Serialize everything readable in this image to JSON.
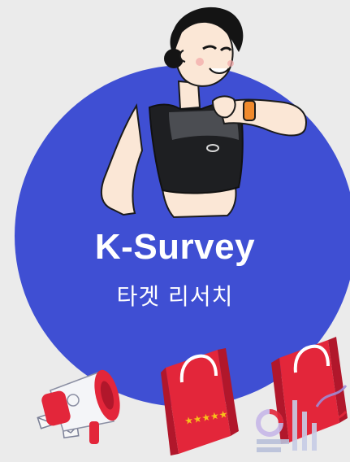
{
  "brand": {
    "title": "K-Survey",
    "subtitle": "타겟 리서치"
  },
  "colors": {
    "background": "#ebebeb",
    "circle": "#3f4fd3",
    "bag_red": "#e3263a",
    "bag_dark": "#b1172b",
    "stars": "#f7c21a",
    "megaphone": "#e3263a"
  },
  "icons": {
    "character": "woman-in-sports-bra-illustration",
    "megaphone": "megaphone-icon",
    "bag_left": "shopping-bag-stars-icon",
    "bag_right": "shopping-bag-icon",
    "chart": "analytics-chart-icon"
  }
}
